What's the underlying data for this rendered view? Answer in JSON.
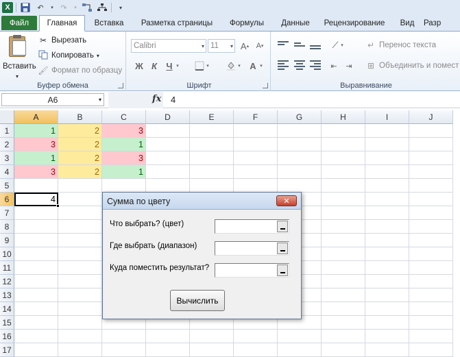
{
  "app": {
    "icon_letter": "X"
  },
  "ribbon_tabs": [
    "Файл",
    "Главная",
    "Вставка",
    "Разметка страницы",
    "Формулы",
    "Данные",
    "Рецензирование",
    "Вид",
    "Разр"
  ],
  "clipboard": {
    "paste_label": "Вставить",
    "cut_label": "Вырезать",
    "copy_label": "Копировать",
    "format_painter_label": "Формат по образцу",
    "group_label": "Буфер обмена"
  },
  "font": {
    "name": "Calibri",
    "size": "11",
    "bold": "Ж",
    "italic": "К",
    "underline": "Ч",
    "grow": "A",
    "shrink": "A",
    "font_color": "A",
    "group_label": "Шрифт"
  },
  "alignment": {
    "wrap_text_label": "Перенос текста",
    "merge_label": "Объединить и помест",
    "group_label": "Выравнивание"
  },
  "formula_bar": {
    "name_box": "A6",
    "fx": "fx",
    "content": "4"
  },
  "columns": [
    "A",
    "B",
    "C",
    "D",
    "E",
    "F",
    "G",
    "H",
    "I",
    "J"
  ],
  "rows": [
    "1",
    "2",
    "3",
    "4",
    "5",
    "6",
    "7",
    "8",
    "9",
    "10",
    "11",
    "12",
    "13",
    "14",
    "15",
    "16",
    "17"
  ],
  "cells": {
    "A1": "1",
    "B1": "2",
    "C1": "3",
    "A2": "3",
    "B2": "2",
    "C2": "1",
    "A3": "1",
    "B3": "2",
    "C3": "3",
    "A4": "3",
    "B4": "2",
    "C4": "1",
    "A6": "4"
  },
  "dialog": {
    "title": "Сумма по цвету",
    "close": "✕",
    "label_color": "Что выбрать? (цвет)",
    "label_range": "Где выбрать (диапазон)",
    "label_result": "Куда поместить результат?",
    "calc_button": "Вычислить"
  }
}
